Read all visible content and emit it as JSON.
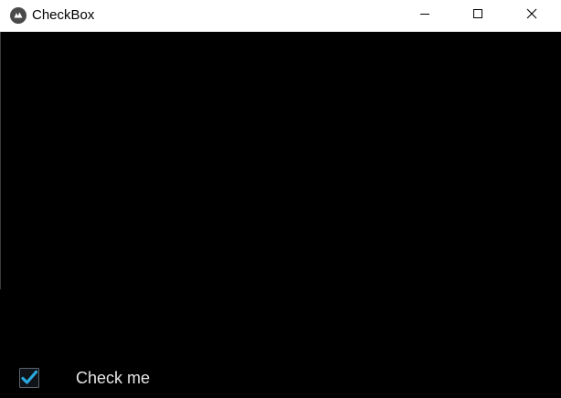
{
  "window": {
    "title": "CheckBox",
    "app_icon": "kivy-logo-icon",
    "controls": {
      "minimize_icon": "minimize-icon",
      "maximize_icon": "maximize-icon",
      "close_icon": "close-icon"
    }
  },
  "checkbox": {
    "label": "Check me",
    "checked": true,
    "check_color": "#2aa8e0"
  }
}
